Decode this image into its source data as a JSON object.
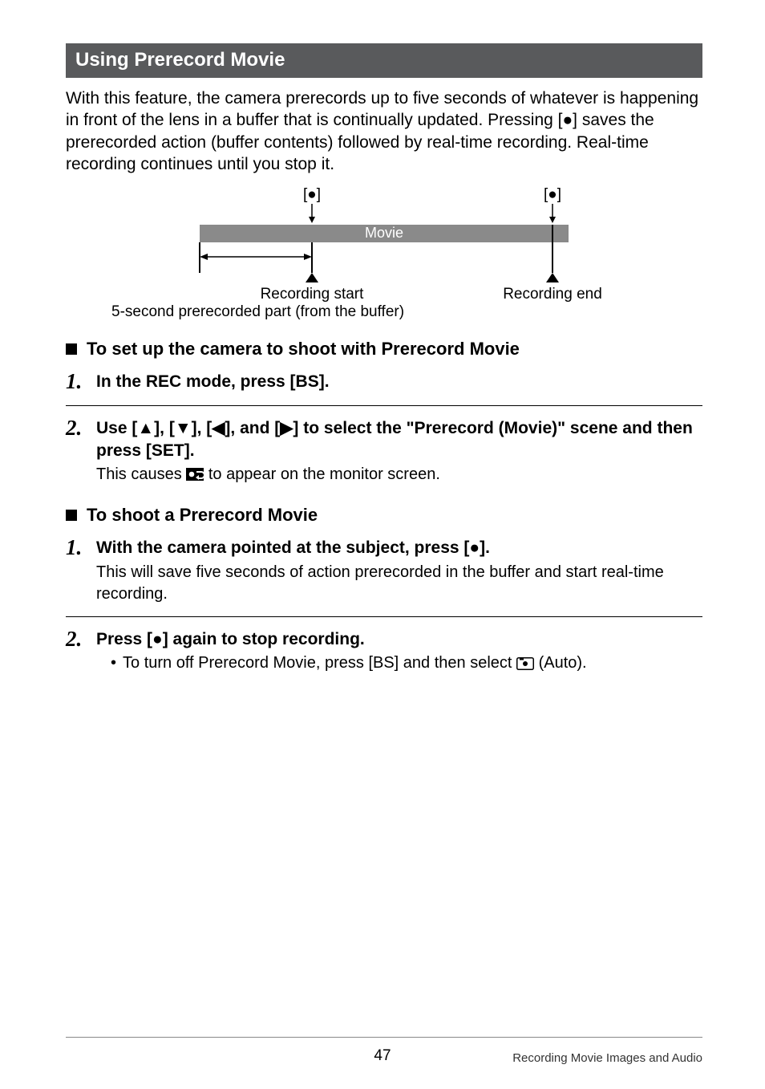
{
  "section_title": "Using Prerecord Movie",
  "intro": "With this feature, the camera prerecords up to five seconds of whatever is happening in front of the lens in a buffer that is continually updated. Pressing [●] saves the prerecorded action (buffer contents) followed by real-time recording. Real-time recording continues until you stop it.",
  "diagram": {
    "rec_btn_left": "[●]",
    "rec_btn_right": "[●]",
    "movie_label": "Movie",
    "recording_start": "Recording start",
    "recording_end": "Recording end",
    "buffer_caption": "5-second prerecorded part (from the buffer)"
  },
  "sub1": "To set up the camera to shoot with Prerecord Movie",
  "step1a": "In the REC mode, press [BS].",
  "step2a_part1": "Use [",
  "step2a_part2": "], [",
  "step2a_part3": "], [",
  "step2a_part4": "], and [",
  "step2a_part5": "] to select the \"Prerecord (Movie)\" scene and then press [SET].",
  "step2a_note_prefix": "This causes ",
  "step2a_note_suffix": " to appear on the monitor screen.",
  "sub2": "To shoot a Prerecord Movie",
  "step1b_prefix": "With the camera pointed at the subject, press [",
  "step1b_suffix": "].",
  "step1b_note": "This will save five seconds of action prerecorded in the buffer and start real-time recording.",
  "step2b_prefix": "Press [",
  "step2b_suffix": "] again to stop recording.",
  "step2b_bullet_prefix": "To turn off Prerecord Movie, press [BS] and then select ",
  "step2b_bullet_suffix": " (Auto).",
  "footer": {
    "page": "47",
    "chapter": "Recording Movie Images and Audio"
  },
  "chart_data": {
    "type": "diagram",
    "description": "Timeline showing prerecord movie buffer and real-time recording",
    "events": [
      {
        "label": "[●]",
        "role": "Recording start button press"
      },
      {
        "label": "[●]",
        "role": "Recording end button press"
      }
    ],
    "segments": [
      {
        "name": "5-second prerecorded part (from the buffer)",
        "position": "before recording start"
      },
      {
        "name": "Movie",
        "position": "between recording start and recording end (total bar)"
      }
    ],
    "labels": [
      "Recording start",
      "Recording end"
    ]
  }
}
